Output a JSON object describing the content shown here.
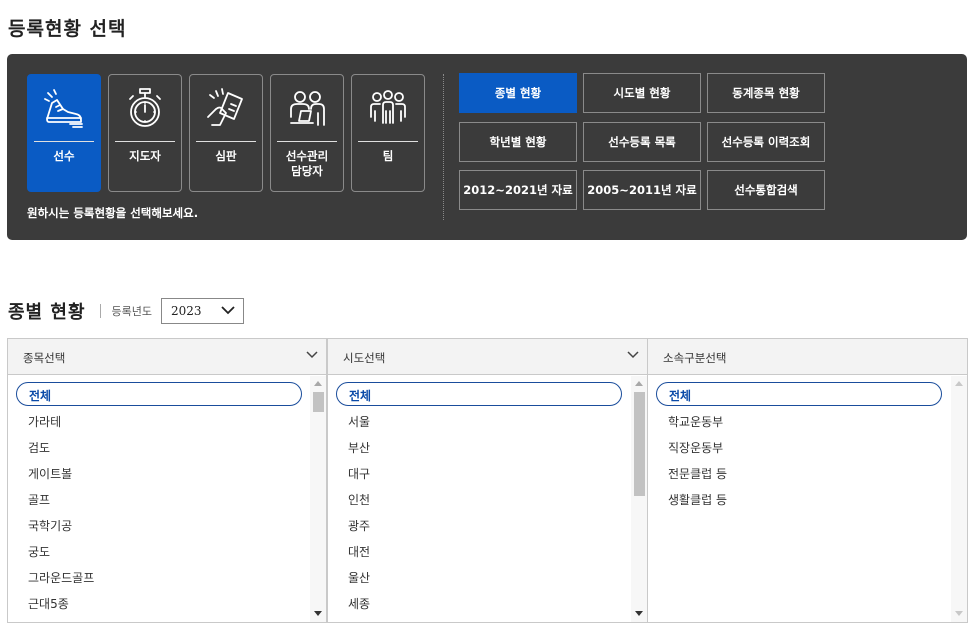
{
  "page_title": "등록현황 선택",
  "roles": [
    {
      "label": "선수",
      "icon": "running-shoe-icon",
      "active": true
    },
    {
      "label": "지도자",
      "icon": "stopwatch-icon",
      "active": false
    },
    {
      "label": "심판",
      "icon": "referee-card-icon",
      "active": false
    },
    {
      "label": "선수관리\n담당자",
      "icon": "manager-group-icon",
      "active": false
    },
    {
      "label": "팀",
      "icon": "team-icon",
      "active": false
    }
  ],
  "panel_note": "원하시는 등록현황을 선택해보세요.",
  "status_buttons": [
    {
      "label": "종별 현황",
      "active": true
    },
    {
      "label": "시도별 현황",
      "active": false
    },
    {
      "label": "동계종목 현황",
      "active": false
    },
    {
      "label": "학년별 현황",
      "active": false
    },
    {
      "label": "선수등록 목록",
      "active": false
    },
    {
      "label": "선수등록 이력조회",
      "active": false
    },
    {
      "label": "2012~2021년 자료",
      "active": false
    },
    {
      "label": "2005~2011년 자료",
      "active": false
    },
    {
      "label": "선수통합검색",
      "active": false
    }
  ],
  "section": {
    "title": "종별 현황",
    "year_label": "등록년도",
    "year_value": "2023"
  },
  "selectors": {
    "sport": {
      "header": "종목선택",
      "options": [
        "전체",
        "가라테",
        "검도",
        "게이트볼",
        "골프",
        "국학기공",
        "궁도",
        "그라운드골프",
        "근대5종"
      ],
      "selected": "전체"
    },
    "region": {
      "header": "시도선택",
      "options": [
        "전체",
        "서울",
        "부산",
        "대구",
        "인천",
        "광주",
        "대전",
        "울산",
        "세종"
      ],
      "selected": "전체"
    },
    "affiliation": {
      "header": "소속구분선택",
      "options": [
        "전체",
        "학교운동부",
        "직장운동부",
        "전문클럽 등",
        "생활클럽 등"
      ],
      "selected": "전체"
    }
  },
  "colors": {
    "accent": "#0a5bc4",
    "panel_bg": "#3b3b3b",
    "selected_outline": "#1a4d9c"
  }
}
